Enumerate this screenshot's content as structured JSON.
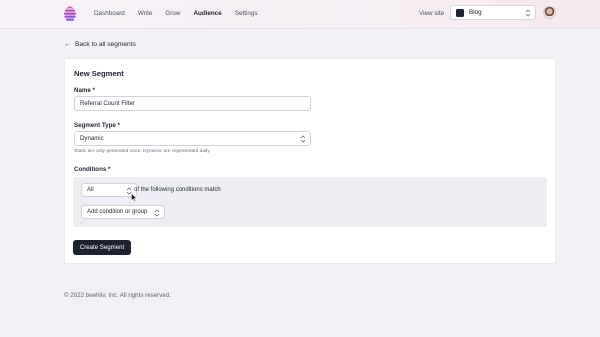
{
  "nav": {
    "items": [
      {
        "label": "Dashboard",
        "active": false
      },
      {
        "label": "Write",
        "active": false
      },
      {
        "label": "Grow",
        "active": false
      },
      {
        "label": "Audience",
        "active": true
      },
      {
        "label": "Settings",
        "active": false
      }
    ],
    "view_site": "View site",
    "publication": "Blog"
  },
  "back_link": "Back to all segments",
  "form": {
    "title": "New Segment",
    "name_label": "Name *",
    "name_value": "Referral Count Filter",
    "type_label": "Segment Type *",
    "type_value": "Dynamic",
    "type_help": "Static are only generated once. Dynamic are regenerated daily.",
    "conditions_label": "Conditions *",
    "match_value": "All",
    "match_text": "of the following conditions match",
    "add_condition": "Add condition or group",
    "submit": "Create Segment"
  },
  "footer": "© 2022 beehiiv, Inc. All rights reserved.",
  "colors": {
    "button_bg": "#1c2230",
    "logo_accent": "#c64fb3",
    "page_bg": "#f2f0f4"
  },
  "icons": [
    "beehiiv-logo",
    "arrow-left-icon",
    "chevron-updown-icon",
    "publication-icon",
    "avatar",
    "cursor-icon"
  ]
}
